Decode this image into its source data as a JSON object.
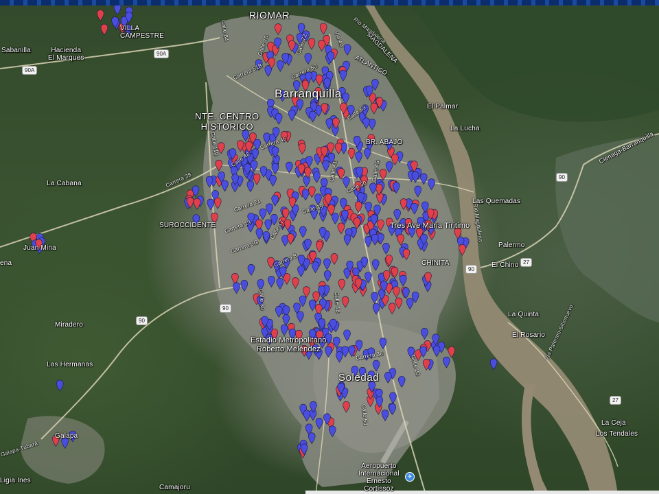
{
  "map": {
    "colors": {
      "marker_blue": "#4a4ee0",
      "marker_red": "#e0404a",
      "river": "#948a73",
      "urban": "#878a80",
      "vegetation": "#3a5230"
    },
    "labels": {
      "riomar": "RIOMAR",
      "villa_campestre": "VILLA\nCAMPESTRE",
      "sabanilla": "Sabanilla",
      "hacienda": "Hacienda\nEl Marques",
      "barranquilla": "Barranquilla",
      "centro": "NTE. CENTRO\nHISTORICO",
      "atlantico": "ATLÁNTICO",
      "magdalena": "MAGDALENA",
      "rio_magdalena_1": "Río Magdalena",
      "rio_magdalena_2": "Río Magdalena",
      "el_palmar": "El Palmar",
      "la_lucha": "La Lucha",
      "cienaga": "Cienaga-Barranquilla",
      "barrio_abajo": "BR. ABAJO",
      "la_cabana": "La Cabana",
      "suroccidente": "SUROCCIDENTE",
      "juan_mina": "Juan Mina",
      "ena": "ena",
      "las_quemadas": "Las Quemadas",
      "tres_ave_maria": "Tres Ave Maria Tiritimo",
      "chinita": "CHINITA",
      "palermo": "Palermo",
      "el_chino": "El Chino",
      "miradero": "Miradero",
      "la_quinta": "La Quinta",
      "el_rosario": "El Rosario",
      "via_palermo": "Vía Palermo-Sitionuevo",
      "estadio": "Estadio Metropolitano\nRoberto Meléndez",
      "las_hermanas": "Las Hermanas",
      "soledad": "Soledad",
      "la_ceja": "La Ceja",
      "los_tendales": "Los Tendales",
      "galapa": "Galapa",
      "galapa_tubara": "Galapa-Tubará",
      "ligia_ines": "Ligia Ines",
      "camajoru": "Camajoru",
      "aeropuerto": "Aeropuerto\nInternacional\nErnesto\nCortissoz",
      "via_40": "Vía 40",
      "streets": [
        "Calle 84",
        "Carrera 51B",
        "Carrera 50",
        "Calle 72",
        "Calle 76",
        "Carrera 38",
        "Calle 53",
        "Calle 48",
        "Carrera 46",
        "Calle 30",
        "Carrera 21",
        "Carrera 13",
        "Calle 17",
        "Carrera 9G",
        "Calle 45",
        "Calle 41",
        "Calle 39",
        "Calle 110",
        "Carrera 8",
        "Calle 18",
        "Calle 30",
        "Carrera 38",
        "Calle 54",
        "Calle 30"
      ]
    },
    "road_shields": [
      "90A",
      "90A",
      "90",
      "90",
      "90",
      "27",
      "27",
      "90"
    ],
    "marker_counts": {
      "blue": 402,
      "red": 167
    }
  }
}
